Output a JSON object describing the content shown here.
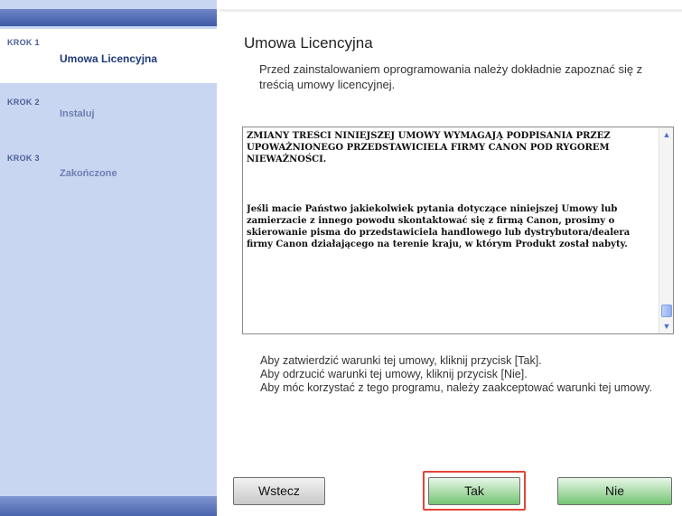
{
  "sidebar": {
    "steps": [
      {
        "number": "KROK 1",
        "name": "Umowa Licencyjna",
        "active": true
      },
      {
        "number": "KROK 2",
        "name": "Instaluj",
        "active": false
      },
      {
        "number": "KROK 3",
        "name": "Zakończone",
        "active": false
      }
    ]
  },
  "main": {
    "title": "Umowa Licencyjna",
    "intro": "Przed zainstalowaniem oprogramowania należy dokładnie zapoznać się z treścią umowy licencyjnej.",
    "license_paragraphs": [
      "ZMIANY TREŚCI NINIEJSZEJ UMOWY WYMAGAJĄ PODPISANIA PRZEZ UPOWAŻNIONEGO PRZEDSTAWICIELA FIRMY CANON POD RYGOREM NIEWAŻNOŚCI.",
      "Jeśli macie Państwo jakiekolwiek pytania dotyczące niniejszej Umowy lub zamierzacie z innego powodu skontaktować się z firmą Canon, prosimy o skierowanie pisma do przedstawiciela handlowego lub dystrybutora/dealera firmy Canon działającego na terenie kraju, w którym Produkt został nabyty."
    ],
    "instructions": [
      "Aby zatwierdzić warunki tej umowy, kliknij przycisk [Tak].",
      "Aby odrzucić warunki tej umowy, kliknij przycisk [Nie].",
      "Aby móc korzystać z tego programu, należy zaakceptować warunki tej umowy."
    ]
  },
  "buttons": {
    "back": "Wstecz",
    "yes": "Tak",
    "no": "Nie"
  },
  "colors": {
    "sidebar_bg": "#c9d6f2",
    "sidebar_header": "#3e5aa6",
    "button_green": "#74c474",
    "highlight_red": "#e2453a"
  },
  "icons": {
    "scroll_up": "▲",
    "scroll_down": "▼"
  }
}
